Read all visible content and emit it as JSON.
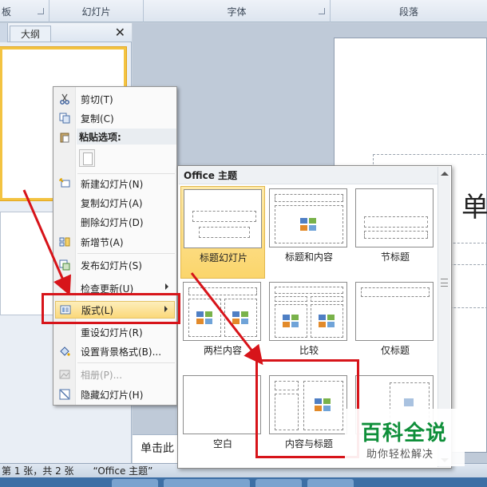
{
  "ribbon": {
    "groups": [
      "板",
      "幻灯片",
      "字体",
      "段落"
    ]
  },
  "pane": {
    "tab_outline": "大纲",
    "close_glyph": "✕"
  },
  "slide": {
    "title_char": "单"
  },
  "notes": {
    "placeholder": "单击此"
  },
  "status": {
    "slide_count": "第 1 张，共 2 张",
    "theme": "“Office 主题”"
  },
  "context_menu": {
    "cut": "剪切(T)",
    "copy": "复制(C)",
    "paste_options": "粘贴选项:",
    "new_slide": "新建幻灯片(N)",
    "duplicate_slide": "复制幻灯片(A)",
    "delete_slide": "删除幻灯片(D)",
    "add_section": "新增节(A)",
    "publish_slides": "发布幻灯片(S)",
    "check_updates": "检查更新(U)",
    "layout": "版式(L)",
    "reset_slide": "重设幻灯片(R)",
    "format_background": "设置背景格式(B)...",
    "photo_album": "相册(P)...",
    "hide_slide": "隐藏幻灯片(H)"
  },
  "layout_menu": {
    "header": "Office 主题",
    "layouts": [
      "标题幻灯片",
      "标题和内容",
      "节标题",
      "两栏内容",
      "比较",
      "仅标题",
      "空白",
      "内容与标题",
      ""
    ]
  },
  "watermark": {
    "main": "百科全说",
    "sub": "助你轻松解决"
  },
  "colors": {
    "highlight": "#fbd87a",
    "annotation_red": "#d7141a",
    "watermark_green": "#0f8f3a"
  }
}
